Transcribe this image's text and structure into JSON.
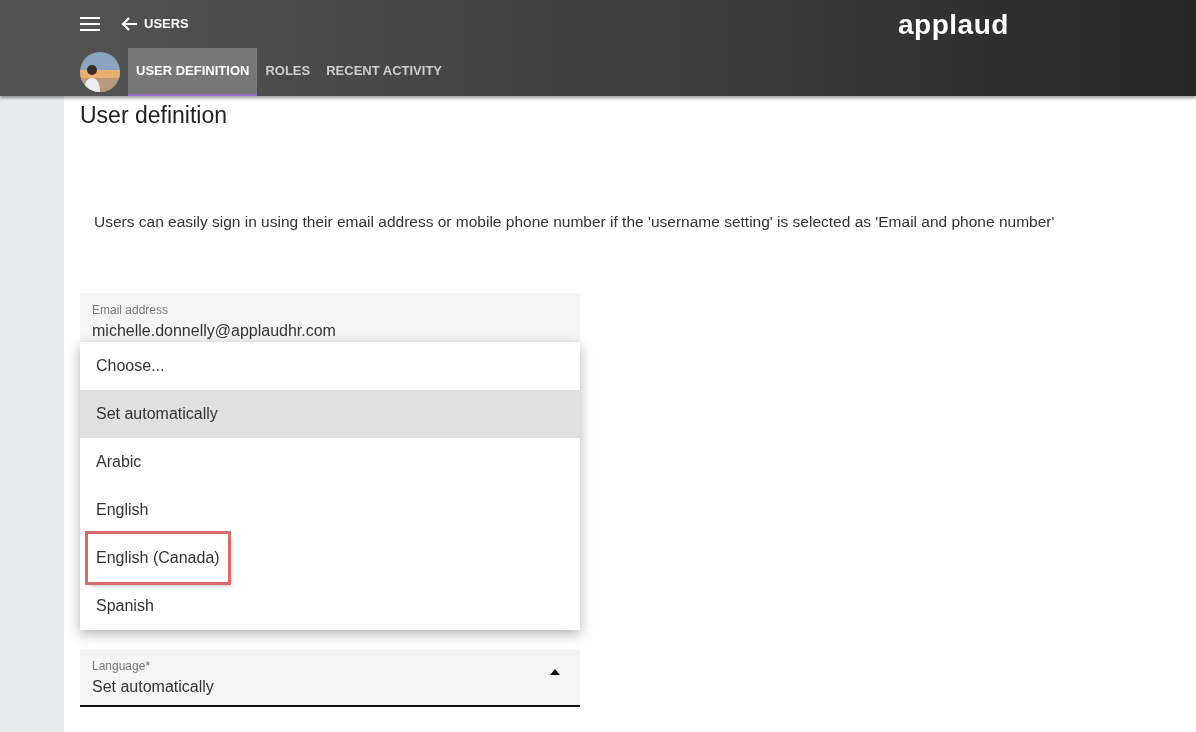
{
  "header": {
    "back_label": "USERS",
    "logo": "applaud",
    "tabs": [
      {
        "label": "USER DEFINITION",
        "selected": true
      },
      {
        "label": "ROLES",
        "selected": false
      },
      {
        "label": "RECENT ACTIVITY",
        "selected": false
      }
    ]
  },
  "page_title": "User definition",
  "info_text": "Users can easily sign in using their email address or mobile phone number if the 'username setting' is selected as 'Email and phone number'",
  "email_field": {
    "label": "Email address",
    "value": "michelle.donnelly@applaudhr.com"
  },
  "language_menu": {
    "options": [
      {
        "label": "Choose...",
        "selected": false,
        "highlighted": false
      },
      {
        "label": "Set automatically",
        "selected": true,
        "highlighted": false
      },
      {
        "label": "Arabic",
        "selected": false,
        "highlighted": false
      },
      {
        "label": "English",
        "selected": false,
        "highlighted": false
      },
      {
        "label": "English (Canada)",
        "selected": false,
        "highlighted": true
      },
      {
        "label": "Spanish",
        "selected": false,
        "highlighted": false
      }
    ]
  },
  "language_field": {
    "label": "Language*",
    "value": "Set automatically",
    "expanded": true
  }
}
